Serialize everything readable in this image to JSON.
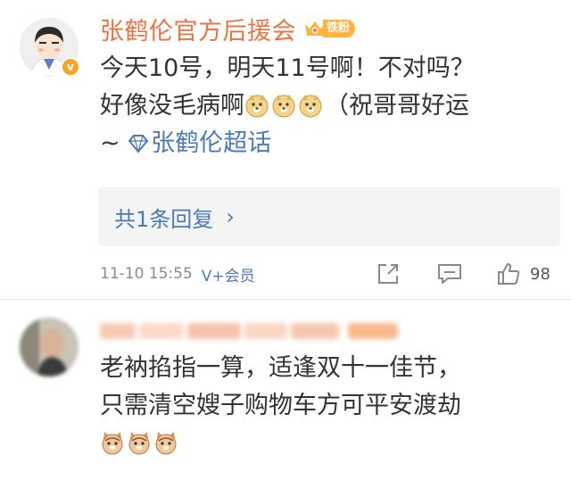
{
  "comment1": {
    "username": "张鹤伦官方后援会",
    "fan_badge": "铁粉",
    "verified_mark": "v",
    "line1": "今天10号，明天11号啊！不对吗？",
    "line2_text": "好像没毛病啊",
    "line2_after": "（祝哥哥好运",
    "line3_prefix": "~ ",
    "super_topic": "张鹤伦超话",
    "reply_count_label": "共1条回复",
    "reply_arrow": "›",
    "timestamp": "11-10 15:55",
    "vip_label": "V+会员",
    "like_count": "98",
    "icons": [
      "share-icon",
      "comment-icon",
      "like-icon",
      "doge-emoji",
      "super-topic-diamond-icon",
      "crown-icon"
    ]
  },
  "comment2": {
    "line1": "老衲掐指一算，适逢双十一佳节，",
    "line2": "只需清空嫂子购物车方可平安渡劫",
    "icons": [
      "cat-emoji"
    ]
  },
  "colors": {
    "username": "#eb7340",
    "link": "#4a7ab7",
    "badge": "#ffb53c",
    "meta": "#8a8a8a"
  }
}
